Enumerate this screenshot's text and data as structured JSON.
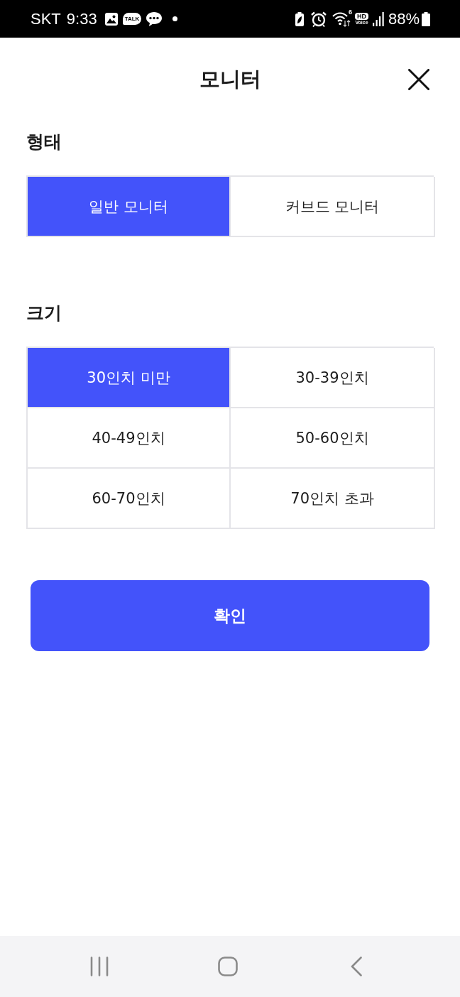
{
  "status_bar": {
    "carrier": "SKT",
    "time": "9:33",
    "talk_badge": "TALK",
    "wifi_band": "6",
    "hd_voice": [
      "HD",
      "Voice"
    ],
    "battery_percent": "88%"
  },
  "header": {
    "title": "모니터"
  },
  "sections": [
    {
      "title": "형태",
      "options": [
        {
          "label": "일반 모니터",
          "selected": true
        },
        {
          "label": "커브드 모니터",
          "selected": false
        }
      ]
    },
    {
      "title": "크기",
      "options": [
        {
          "label": "30인치 미만",
          "selected": true
        },
        {
          "label": "30-39인치",
          "selected": false
        },
        {
          "label": "40-49인치",
          "selected": false
        },
        {
          "label": "50-60인치",
          "selected": false
        },
        {
          "label": "60-70인치",
          "selected": false
        },
        {
          "label": "70인치 초과",
          "selected": false
        }
      ]
    }
  ],
  "confirm_button": {
    "label": "확인"
  }
}
